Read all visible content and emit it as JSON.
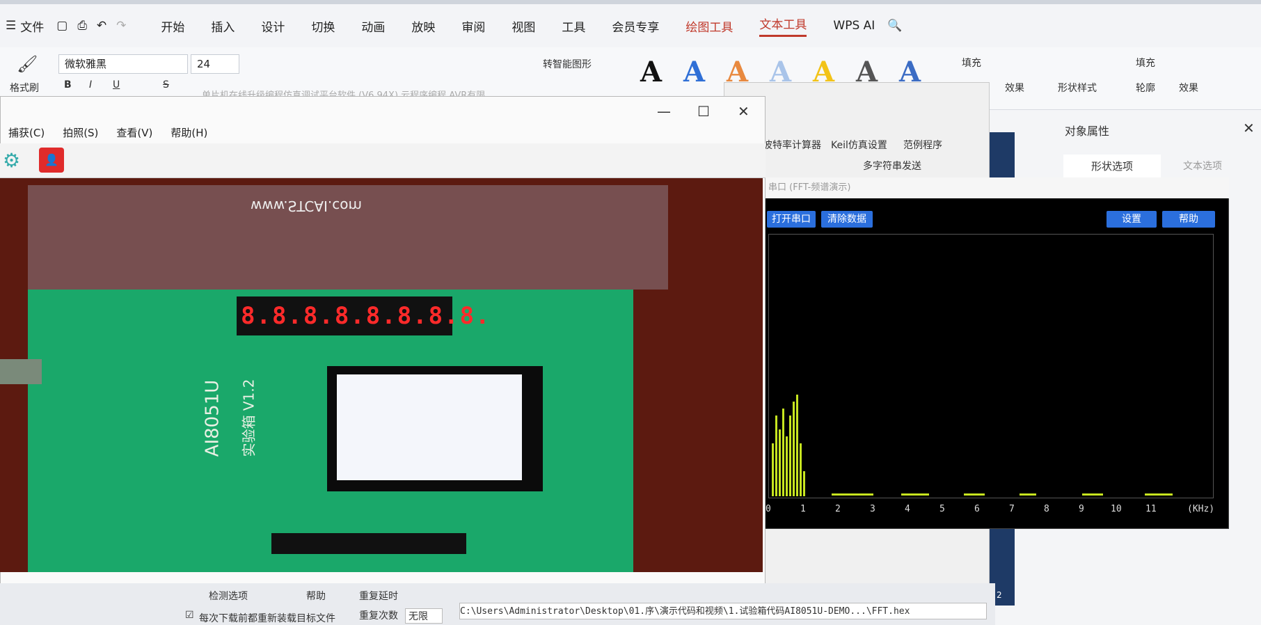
{
  "wps": {
    "menu": [
      "文件",
      "开始",
      "插入",
      "设计",
      "切换",
      "动画",
      "放映",
      "审阅",
      "视图",
      "工具",
      "会员专享",
      "绘图工具",
      "文本工具",
      "WPS AI"
    ],
    "font_name": "微软雅黑",
    "font_size": "24",
    "format_painter": "格式刷",
    "smart_shape": "转智能图形",
    "fill": "填充",
    "effect": "效果",
    "shape_style": "形状样式",
    "outline": "轮廓",
    "fill2": "填充",
    "effect2": "效果",
    "panel_title": "对象属性",
    "tab_shape": "形状选项",
    "tab_text": "文本选项",
    "slide_number": "2"
  },
  "isp": {
    "title": "单片机在线升级编程仿真调试平台软件 (V6.94X) 云程序编程 AVR有限",
    "tabs": [
      "波特率计算器",
      "Keil仿真设置",
      "范例程序"
    ],
    "multi_send": "多字符串发送",
    "bottom_left1": "检测选项",
    "bottom_left2": "帮助",
    "repeat_delay": "重复延时",
    "repeat_count": "重复次数",
    "repeat_count_val": "无限",
    "redownload": "每次下载前都重新装载目标文件",
    "path": "C:\\Users\\Administrator\\Desktop\\01.序\\演示代码和视频\\1.试验箱代码AI8051U-DEMO...\\FFT.hex"
  },
  "fft": {
    "title": "串口 (FFT-频谱演示)",
    "open_port": "打开串口",
    "clear": "清除数据",
    "settings": "设置",
    "help": "帮助",
    "ticks": [
      "0",
      "1",
      "2",
      "3",
      "4",
      "5",
      "6",
      "7",
      "8",
      "9",
      "10",
      "11"
    ],
    "unit": "(KHz)"
  },
  "camera": {
    "menu": [
      "捕获(C)",
      "拍照(S)",
      "查看(V)",
      "帮助(H)"
    ],
    "board_label": "AI8051U",
    "board_sub": "实验箱 V1.2",
    "site": "www.STCAI.com",
    "segment": "8.8.8.8.8.8.8.8."
  }
}
